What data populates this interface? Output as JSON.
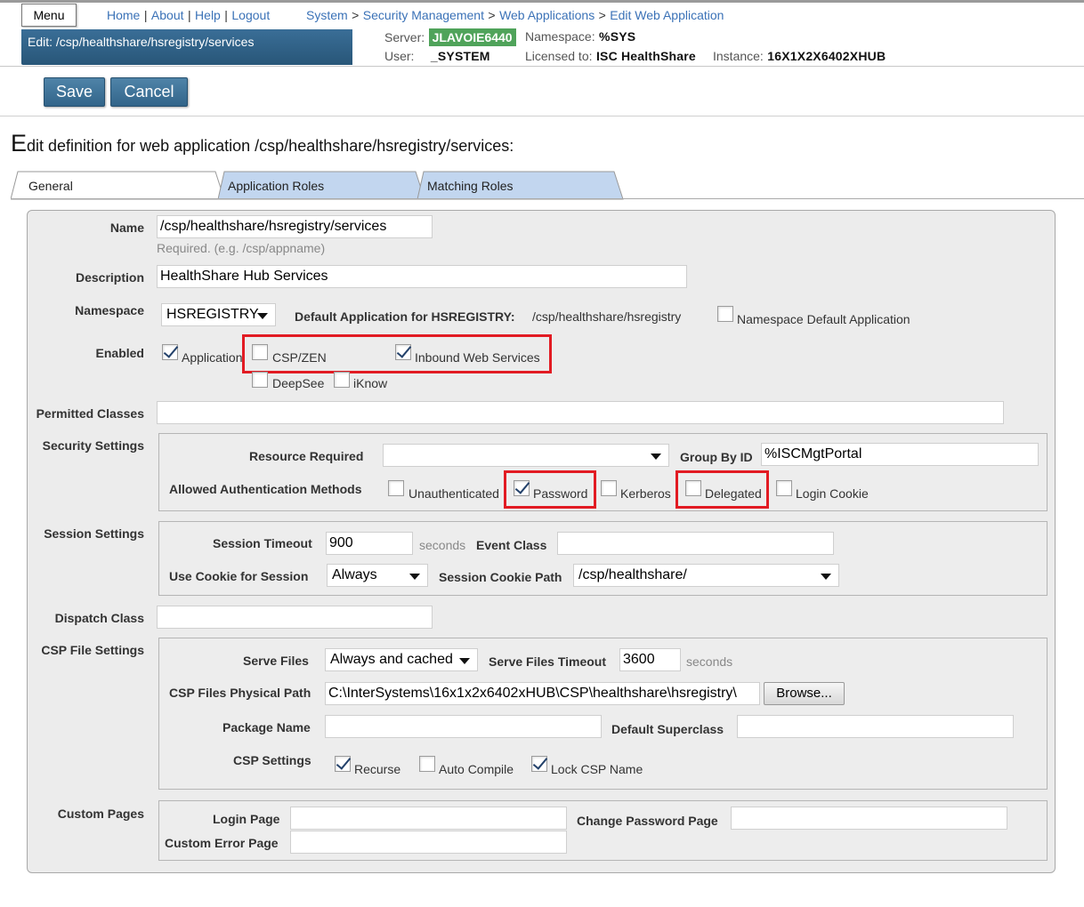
{
  "header": {
    "menu_label": "Menu",
    "links": [
      "Home",
      "About",
      "Help",
      "Logout"
    ],
    "breadcrumb": [
      "System",
      "Security Management",
      "Web Applications",
      "Edit Web Application"
    ],
    "title": "Edit: /csp/healthshare/hsregistry/services",
    "server_label": "Server:",
    "server": "JLAVOIE6440",
    "namespace_label": "Namespace:",
    "namespace": "%SYS",
    "user_label": "User:",
    "user": "_SYSTEM",
    "licensed_label": "Licensed to:",
    "licensed": "ISC HealthShare",
    "instance_label": "Instance:",
    "instance": "16X1X2X6402XHUB"
  },
  "toolbar": {
    "save_label": "Save",
    "cancel_label": "Cancel"
  },
  "heading": {
    "first_letter": "E",
    "rest": "dit definition for web application /csp/healthshare/hsregistry/services:"
  },
  "tabs": [
    "General",
    "Application Roles",
    "Matching Roles"
  ],
  "form": {
    "name_label": "Name",
    "name_value": "/csp/healthshare/hsregistry/services",
    "name_hint": "Required. (e.g. /csp/appname)",
    "description_label": "Description",
    "description_value": "HealthShare Hub Services",
    "namespace_label": "Namespace",
    "namespace_value": "HSREGISTRY",
    "default_app_label": "Default Application for HSREGISTRY:",
    "default_app_value": "/csp/healthshare/hsregistry",
    "ns_default_label": "Namespace Default Application",
    "enabled_label": "Enabled",
    "enabled_options": {
      "application": "Application",
      "csp_zen": "CSP/ZEN",
      "inbound_ws": "Inbound Web Services",
      "deepsee": "DeepSee",
      "iknow": "iKnow"
    },
    "permitted_label": "Permitted Classes",
    "security": {
      "section_label": "Security Settings",
      "resource_label": "Resource Required",
      "resource_value": "",
      "group_label": "Group By ID",
      "group_value": "%ISCMgtPortal",
      "auth_label": "Allowed Authentication Methods",
      "auth": {
        "unauthenticated": "Unauthenticated",
        "password": "Password",
        "kerberos": "Kerberos",
        "delegated": "Delegated",
        "login_cookie": "Login Cookie"
      }
    },
    "session": {
      "section_label": "Session Settings",
      "timeout_label": "Session Timeout",
      "timeout_value": "900",
      "seconds": "seconds",
      "event_label": "Event Class",
      "cookie_label": "Use Cookie for Session",
      "cookie_value": "Always",
      "cookie_path_label": "Session Cookie Path",
      "cookie_path_value": "/csp/healthshare/"
    },
    "dispatch_label": "Dispatch Class",
    "csp_files": {
      "section_label": "CSP File Settings",
      "serve_label": "Serve Files",
      "serve_value": "Always and cached",
      "serve_timeout_label": "Serve Files Timeout",
      "serve_timeout_value": "3600",
      "seconds": "seconds",
      "path_label": "CSP Files Physical Path",
      "path_value": "C:\\InterSystems\\16x1x2x6402xHUB\\CSP\\healthshare\\hsregistry\\",
      "browse_label": "Browse...",
      "package_label": "Package Name",
      "superclass_label": "Default Superclass",
      "settings_label": "CSP Settings",
      "recurse": "Recurse",
      "auto_compile": "Auto Compile",
      "lock_name": "Lock CSP Name"
    },
    "custom": {
      "section_label": "Custom Pages",
      "login_label": "Login Page",
      "change_pw_label": "Change Password Page",
      "error_label": "Custom Error Page"
    }
  }
}
